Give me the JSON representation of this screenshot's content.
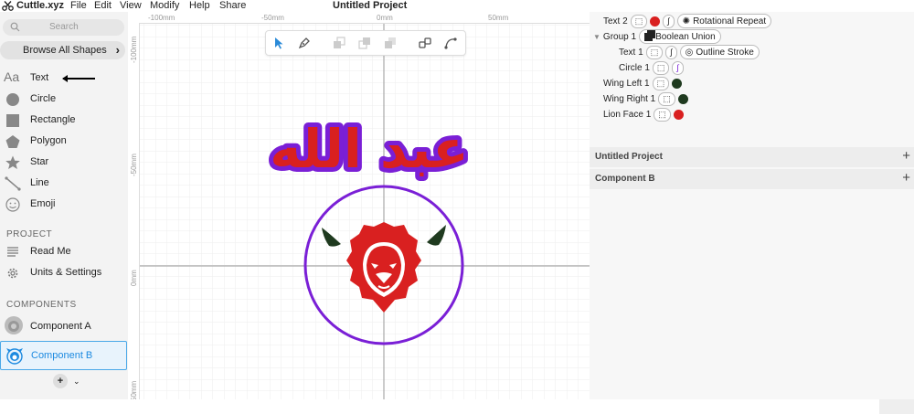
{
  "app": {
    "name": "Cuttle.xyz",
    "title": "Untitled Project"
  },
  "menu": [
    "File",
    "Edit",
    "View",
    "Modify",
    "Help",
    "Share"
  ],
  "sidebar": {
    "search_placeholder": "Search",
    "browse_label": "Browse All Shapes",
    "tools": [
      {
        "label": "Text",
        "icon": "text-icon"
      },
      {
        "label": "Circle",
        "icon": "circle-icon"
      },
      {
        "label": "Rectangle",
        "icon": "rectangle-icon"
      },
      {
        "label": "Polygon",
        "icon": "polygon-icon"
      },
      {
        "label": "Star",
        "icon": "star-icon"
      },
      {
        "label": "Line",
        "icon": "line-icon"
      },
      {
        "label": "Emoji",
        "icon": "emoji-icon"
      }
    ],
    "project_heading": "PROJECT",
    "project_items": [
      {
        "label": "Read Me",
        "icon": "document-icon"
      },
      {
        "label": "Units & Settings",
        "icon": "gear-icon"
      }
    ],
    "components_heading": "COMPONENTS",
    "components": [
      {
        "label": "Component A",
        "selected": false
      },
      {
        "label": "Component B",
        "selected": true
      }
    ]
  },
  "rulers": {
    "top": [
      "-100mm",
      "-50mm",
      "0mm",
      "50mm"
    ],
    "left": [
      "-100mm",
      "-50mm",
      "0mm",
      "50mm"
    ]
  },
  "canvas": {
    "arabic_text": "عبد الله",
    "colors": {
      "text_fill": "#d92020",
      "text_outline": "#7a1fd6",
      "circle_stroke": "#7a1fd6",
      "wings": "#1f3a1f",
      "lion": "#d92020"
    }
  },
  "layers": [
    {
      "name": "Text 2",
      "modifier": "Rotational Repeat"
    },
    {
      "name": "Group 1",
      "modifier": "Boolean Union"
    },
    {
      "name": "Text 1",
      "modifier": "Outline Stroke"
    },
    {
      "name": "Circle 1"
    },
    {
      "name": "Wing Left 1"
    },
    {
      "name": "Wing Right 1"
    },
    {
      "name": "Lion Face 1"
    }
  ],
  "panels": [
    {
      "label": "Untitled Project"
    },
    {
      "label": "Component B"
    }
  ]
}
